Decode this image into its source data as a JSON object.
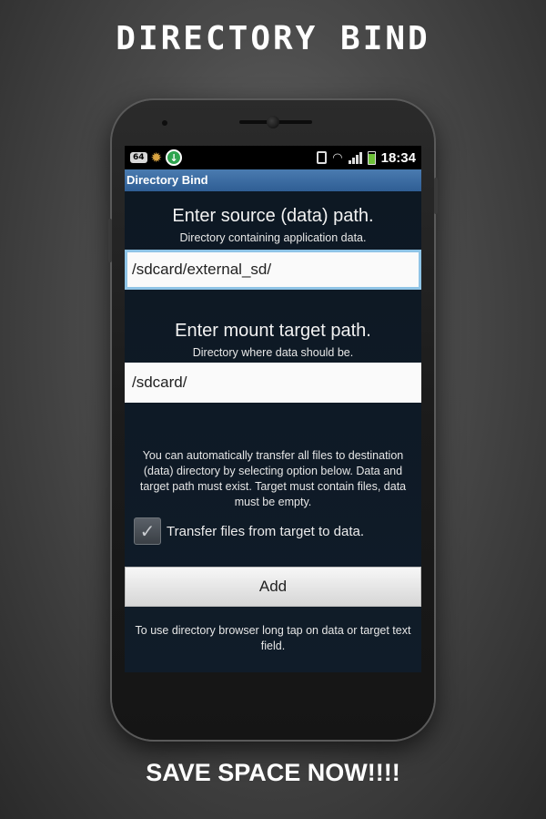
{
  "promo": {
    "title": "DIRECTORY BIND",
    "footer": "SAVE SPACE NOW!!!!"
  },
  "statusbar": {
    "badge": "64",
    "time": "18:34",
    "icons": [
      "64-badge-icon",
      "gear-icon",
      "download-icon",
      "vibrate-icon",
      "wifi-icon",
      "signal-icon",
      "battery-icon"
    ]
  },
  "app": {
    "title": "Directory Bind"
  },
  "source": {
    "heading": "Enter source (data) path.",
    "subtext": "Directory containing application data.",
    "value": "/sdcard/external_sd/"
  },
  "target": {
    "heading": "Enter mount target path.",
    "subtext": "Directory where data should be.",
    "value": "/sdcard/"
  },
  "transfer": {
    "info": "You can automatically transfer all files to destination (data) directory by selecting option below. Data and target path must exist. Target must contain files, data must be empty.",
    "checkbox_label": "Transfer files from target to data.",
    "checked": true
  },
  "actions": {
    "add_label": "Add"
  },
  "hint": "To use directory browser long tap on data or target text field.",
  "colors": {
    "appbar": "#3a6aa0",
    "focus_border": "#8fc4e6",
    "screen_bg": "#0c1520"
  }
}
